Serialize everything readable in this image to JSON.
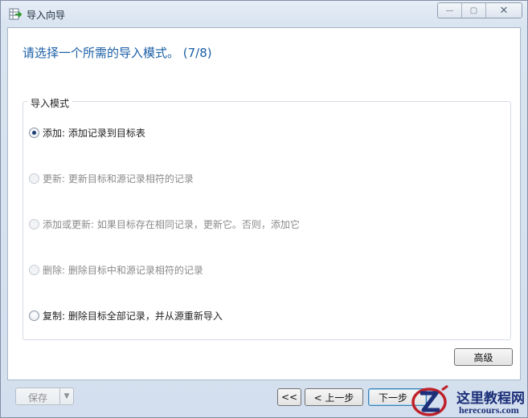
{
  "window": {
    "title": "导入向导",
    "caption": {
      "minimize": "—",
      "maximize": "▢",
      "close": "✕"
    }
  },
  "headline": "请选择一个所需的导入模式。 (7/8)",
  "import_mode": {
    "legend": "导入模式",
    "options": [
      {
        "label": "添加: 添加记录到目标表",
        "selected": true,
        "enabled": true
      },
      {
        "label": "更新: 更新目标和源记录相符的记录",
        "selected": false,
        "enabled": false
      },
      {
        "label": "添加或更新: 如果目标存在相同记录，更新它。否则，添加它",
        "selected": false,
        "enabled": false
      },
      {
        "label": "删除: 删除目标中和源记录相符的记录",
        "selected": false,
        "enabled": false
      },
      {
        "label": "复制: 删除目标全部记录，并从源重新导入",
        "selected": false,
        "enabled": true
      }
    ]
  },
  "buttons": {
    "advanced": "高级",
    "save": "保存",
    "first": "<<",
    "prev": "< 上一步",
    "next": "下一步"
  },
  "watermark": {
    "title": "这里教程网",
    "url": "herecours.com"
  },
  "colors": {
    "headline": "#1b5fa6",
    "accent": "#3c7fb1"
  }
}
